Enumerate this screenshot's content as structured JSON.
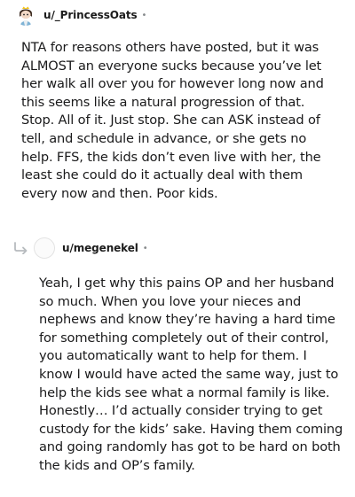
{
  "comments": [
    {
      "username": "u/_PrincessOats",
      "separator": "•",
      "avatar": "snoo-avatar-icon",
      "body": "NTA for reasons others have posted, but it was ALMOST an everyone sucks because you’ve let her walk all over you for however long now and this seems like a natural progression of that. Stop. All of it. Just stop. She can ASK instead of tell, and schedule in advance, or she gets no help. FFS, the kids don’t even live with her, the least she could do it actually deal with them every now and then. Poor kids."
    },
    {
      "username": "u/megenekel",
      "separator": "•",
      "avatar": "default-avatar-icon",
      "reply_icon": "reply-arrow-icon",
      "body": "Yeah, I get why this pains OP and her husband so much. When you love your nieces and nephews and know they’re having a hard time for something completely out of their control, you automatically want to help for them. I know I would have acted the same way, just to help the kids see what a normal family is like. Honestly… I’d actually consider trying to get custody for the kids’ sake. Having them coming and going randomly has got to be hard on both the kids and OP’s family."
    }
  ]
}
